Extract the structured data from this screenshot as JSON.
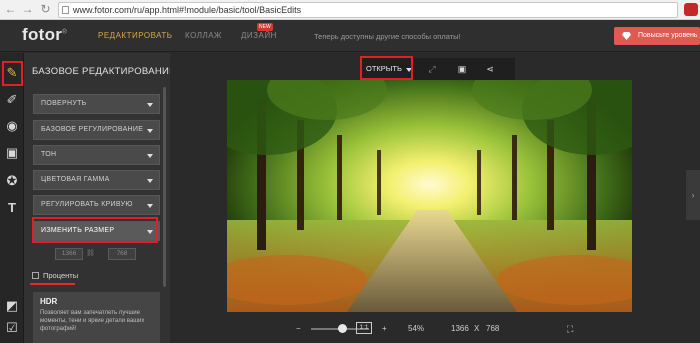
{
  "browser": {
    "url": "www.fotor.com/ru/app.html#!module/basic/tool/BasicEdits"
  },
  "header": {
    "logo": "fotor",
    "logo_mark": "®",
    "nav": {
      "edit": "РЕДАКТИРОВАТЬ",
      "collage": "КОЛЛАЖ",
      "design": "ДИЗАЙН"
    },
    "new_badge": "NEW",
    "notice": "Теперь доступны другие способы оплаты!",
    "upgrade_label": "Повысьте уровень"
  },
  "tools": [
    "pencil-icon",
    "brush-icon",
    "eye-icon",
    "frame-icon",
    "star-icon",
    "text-icon",
    "layers-icon",
    "edit-square-icon"
  ],
  "panel": {
    "title": "БАЗОВОЕ РЕДАКТИРОВАНИЕ",
    "items": [
      "ПОВЕРНУТЬ",
      "БАЗОВОЕ РЕГУЛИРОВАНИЕ",
      "ТОН",
      "ЦВЕТОВАЯ ГАММА",
      "РЕГУЛИРОВАТЬ КРИВУЮ",
      "ИЗМЕНИТЬ РАЗМЕР"
    ],
    "width_value": "1366",
    "height_value": "768",
    "percent_label": "Проценты",
    "percent_checked": false,
    "hdr_title": "HDR",
    "hdr_desc": "Позволяет вам запечатлеть лучшие моменты, тени и яркие детали ваших фотографий!"
  },
  "canvas": {
    "open_label": "ОТКРЫТЬ",
    "zoom_minus": "−",
    "zoom_plus": "+",
    "zoom_level": "54%",
    "zoom_fraction": 0.54,
    "dims_w": "1366",
    "dims_x": "X",
    "dims_h": "768",
    "ratio_label": "1:1"
  },
  "colors": {
    "highlight": "#e21f26",
    "upgrade_bg": "#e05a52",
    "edit_nav": "#d8a74a"
  }
}
